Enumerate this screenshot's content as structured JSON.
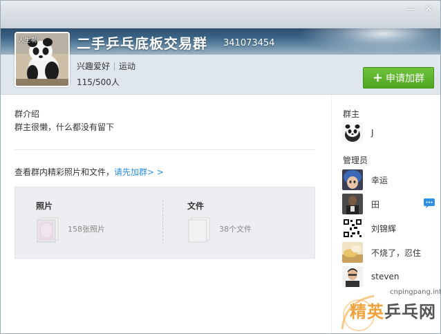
{
  "window": {
    "controls": [
      "—",
      "✕"
    ]
  },
  "header": {
    "group_name": "二手乒乓底板交易群",
    "group_id": "341073454",
    "tags": [
      "兴趣爱好",
      "运动"
    ],
    "member_count": "115/500人",
    "join_button_label": "申请加群",
    "avatar_caption": "人生啊!"
  },
  "intro": {
    "title": "群介绍",
    "description": "群主很懒，什么都没有留下"
  },
  "prompt": {
    "text": "查看群内精彩照片和文件，",
    "link": "请先加群> >"
  },
  "media": {
    "photos": {
      "title": "照片",
      "count_label": "158张照片"
    },
    "files": {
      "title": "文件",
      "count_label": "38个文件"
    }
  },
  "sidebar": {
    "owner_title": "群主",
    "owner": {
      "name": "J",
      "avatar": "panda-avatar"
    },
    "admin_title": "管理员",
    "admins": [
      {
        "name": "幸运",
        "avatar": "blue-hair-avatar"
      },
      {
        "name": "田",
        "avatar": "player-avatar"
      },
      {
        "name": "刘锦辉",
        "avatar": "qr-code-avatar"
      },
      {
        "name": "不烧了，忍住",
        "avatar": "food-avatar"
      },
      {
        "name": "steven",
        "avatar": "man-avatar"
      }
    ]
  },
  "watermark": {
    "site": "cnpingpang.info",
    "text_a": "精英",
    "text_b": "乒乓网"
  },
  "colors": {
    "join_green": "#5cb52a",
    "link_blue": "#2a8ed9",
    "chat_blue": "#2f8fe0"
  }
}
